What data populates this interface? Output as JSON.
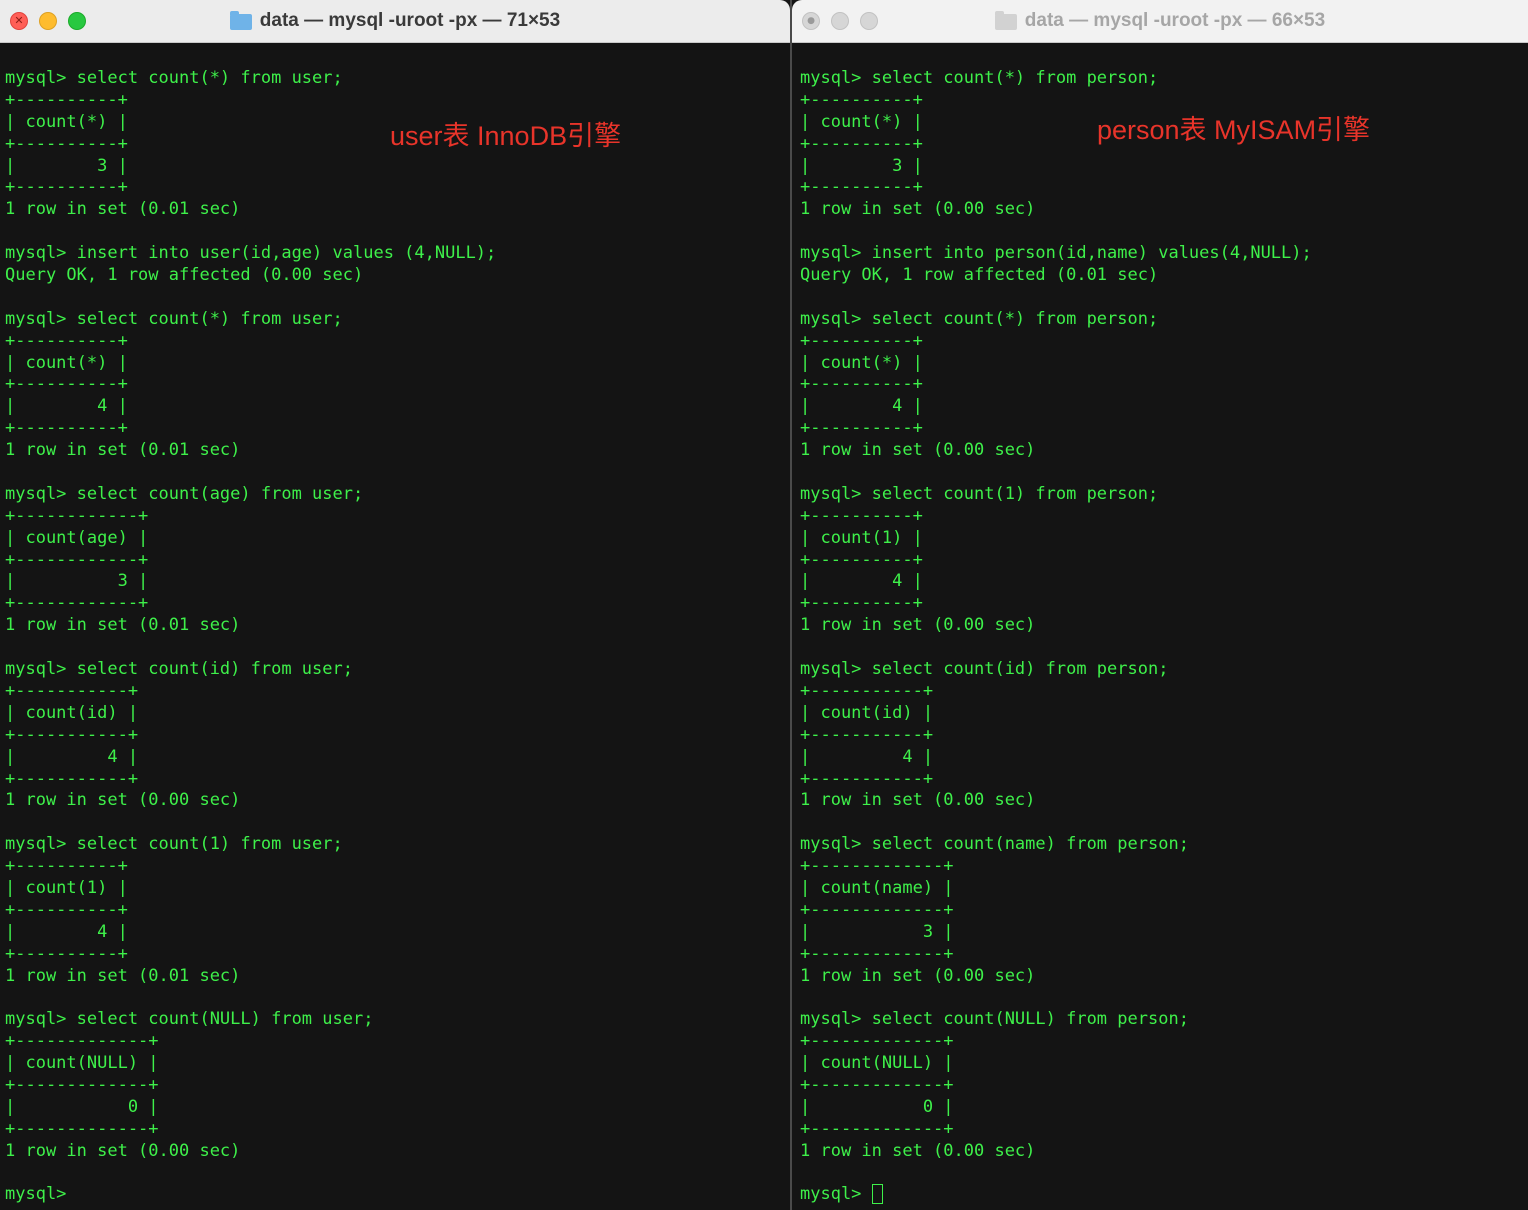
{
  "left_window": {
    "title": "data — mysql -uroot -px — 71×53",
    "annotation": "user表 InnoDB引擎",
    "lines": [
      "mysql> select count(*) from user;",
      "+----------+",
      "| count(*) |",
      "+----------+",
      "|        3 |",
      "+----------+",
      "1 row in set (0.01 sec)",
      "",
      "mysql> insert into user(id,age) values (4,NULL);",
      "Query OK, 1 row affected (0.00 sec)",
      "",
      "mysql> select count(*) from user;",
      "+----------+",
      "| count(*) |",
      "+----------+",
      "|        4 |",
      "+----------+",
      "1 row in set (0.01 sec)",
      "",
      "mysql> select count(age) from user;",
      "+------------+",
      "| count(age) |",
      "+------------+",
      "|          3 |",
      "+------------+",
      "1 row in set (0.01 sec)",
      "",
      "mysql> select count(id) from user;",
      "+-----------+",
      "| count(id) |",
      "+-----------+",
      "|         4 |",
      "+-----------+",
      "1 row in set (0.00 sec)",
      "",
      "mysql> select count(1) from user;",
      "+----------+",
      "| count(1) |",
      "+----------+",
      "|        4 |",
      "+----------+",
      "1 row in set (0.01 sec)",
      "",
      "mysql> select count(NULL) from user;",
      "+-------------+",
      "| count(NULL) |",
      "+-------------+",
      "|           0 |",
      "+-------------+",
      "1 row in set (0.00 sec)",
      "",
      "mysql> "
    ]
  },
  "right_window": {
    "title": "data — mysql -uroot -px — 66×53",
    "annotation": "person表 MyISAM引擎",
    "lines": [
      "mysql> select count(*) from person;",
      "+----------+",
      "| count(*) |",
      "+----------+",
      "|        3 |",
      "+----------+",
      "1 row in set (0.00 sec)",
      "",
      "mysql> insert into person(id,name) values(4,NULL);",
      "Query OK, 1 row affected (0.01 sec)",
      "",
      "mysql> select count(*) from person;",
      "+----------+",
      "| count(*) |",
      "+----------+",
      "|        4 |",
      "+----------+",
      "1 row in set (0.00 sec)",
      "",
      "mysql> select count(1) from person;",
      "+----------+",
      "| count(1) |",
      "+----------+",
      "|        4 |",
      "+----------+",
      "1 row in set (0.00 sec)",
      "",
      "mysql> select count(id) from person;",
      "+-----------+",
      "| count(id) |",
      "+-----------+",
      "|         4 |",
      "+-----------+",
      "1 row in set (0.00 sec)",
      "",
      "mysql> select count(name) from person;",
      "+-------------+",
      "| count(name) |",
      "+-------------+",
      "|           3 |",
      "+-------------+",
      "1 row in set (0.00 sec)",
      "",
      "mysql> select count(NULL) from person;",
      "+-------------+",
      "| count(NULL) |",
      "+-------------+",
      "|           0 |",
      "+-------------+",
      "1 row in set (0.00 sec)",
      "",
      "mysql> "
    ]
  },
  "colors": {
    "terminal_text": "#3ef04a",
    "terminal_bg": "#141414",
    "annotation": "#e8342a"
  }
}
